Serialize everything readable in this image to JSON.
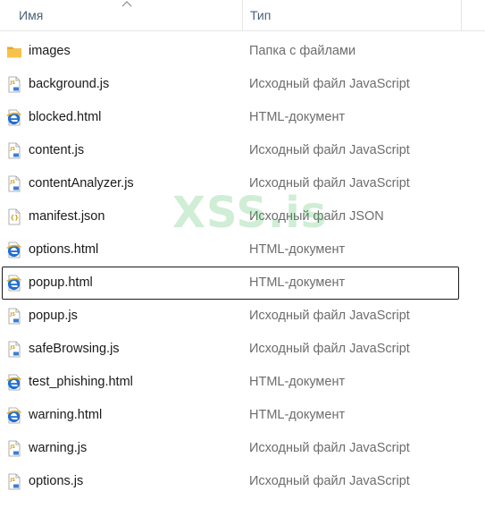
{
  "columns": {
    "name": "Имя",
    "type": "Тип"
  },
  "files": [
    {
      "name": "images",
      "type": "Папка с файлами",
      "icon": "folder-icon"
    },
    {
      "name": "background.js",
      "type": "Исходный файл JavaScript",
      "icon": "js-file-icon"
    },
    {
      "name": "blocked.html",
      "type": "HTML-документ",
      "icon": "edge-html-icon"
    },
    {
      "name": "content.js",
      "type": "Исходный файл JavaScript",
      "icon": "js-file-icon"
    },
    {
      "name": "contentAnalyzer.js",
      "type": "Исходный файл JavaScript",
      "icon": "js-file-icon"
    },
    {
      "name": "manifest.json",
      "type": "Исходный файл JSON",
      "icon": "json-file-icon"
    },
    {
      "name": "options.html",
      "type": "HTML-документ",
      "icon": "edge-html-icon"
    },
    {
      "name": "popup.html",
      "type": "HTML-документ",
      "icon": "edge-html-icon",
      "focused": true
    },
    {
      "name": "popup.js",
      "type": "Исходный файл JavaScript",
      "icon": "js-file-icon"
    },
    {
      "name": "safeBrowsing.js",
      "type": "Исходный файл JavaScript",
      "icon": "js-file-icon"
    },
    {
      "name": "test_phishing.html",
      "type": "HTML-документ",
      "icon": "edge-html-icon"
    },
    {
      "name": "warning.html",
      "type": "HTML-документ",
      "icon": "edge-html-icon"
    },
    {
      "name": "warning.js",
      "type": "Исходный файл JavaScript",
      "icon": "js-file-icon"
    },
    {
      "name": "options.js",
      "type": "Исходный файл JavaScript",
      "icon": "js-file-icon"
    }
  ],
  "watermark": "XSS.is",
  "colors": {
    "header_text": "#4c607a",
    "type_text": "#6d6d6d",
    "folder": "#f8c24a",
    "edge_blue": "#1f6fd1",
    "watermark_green": "#2fb24a"
  }
}
